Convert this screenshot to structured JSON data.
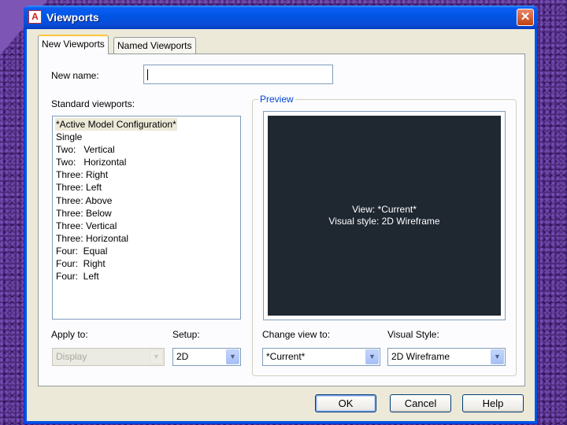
{
  "window": {
    "title": "Viewports",
    "icon_glyph": "A",
    "close_glyph": "✕"
  },
  "tabs": [
    {
      "label": "New Viewports",
      "active": true
    },
    {
      "label": "Named Viewports",
      "active": false
    }
  ],
  "new_name": {
    "label": "New name:",
    "value": ""
  },
  "standard_viewports": {
    "label": "Standard viewports:",
    "items": [
      "*Active Model Configuration*",
      "Single",
      "Two:   Vertical",
      "Two:   Horizontal",
      "Three: Right",
      "Three: Left",
      "Three: Above",
      "Three: Below",
      "Three: Vertical",
      "Three: Horizontal",
      "Four:  Equal",
      "Four:  Right",
      "Four:  Left"
    ],
    "selected_index": 0
  },
  "preview": {
    "label": "Preview",
    "line1": "View: *Current*",
    "line2": "Visual style: 2D Wireframe"
  },
  "apply_to": {
    "label": "Apply to:",
    "value": "Display",
    "disabled": true
  },
  "setup": {
    "label": "Setup:",
    "value": "2D"
  },
  "change_view": {
    "label": "Change view to:",
    "value": "*Current*"
  },
  "visual_style": {
    "label": "Visual Style:",
    "value": "2D Wireframe"
  },
  "buttons": {
    "ok": "OK",
    "cancel": "Cancel",
    "help": "Help"
  },
  "colors": {
    "titlebar": "#0054e3",
    "preview_background": "#1f2731",
    "group_label": "#0046d5"
  },
  "icons": [
    "autocad-app-icon",
    "close-icon",
    "chevron-down-icon"
  ]
}
